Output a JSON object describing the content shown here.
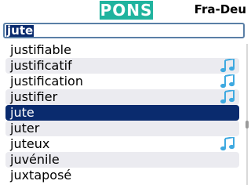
{
  "header": {
    "logo": "PONS",
    "language_pair": "Fra-Deu"
  },
  "search": {
    "value": "jute"
  },
  "list": {
    "items": [
      {
        "label": "justifiable",
        "audio": false,
        "selected": false
      },
      {
        "label": "justificatif",
        "audio": true,
        "selected": false
      },
      {
        "label": "justification",
        "audio": true,
        "selected": false
      },
      {
        "label": "justifier",
        "audio": true,
        "selected": false
      },
      {
        "label": "jute",
        "audio": false,
        "selected": true
      },
      {
        "label": "juter",
        "audio": false,
        "selected": false
      },
      {
        "label": "juteux",
        "audio": true,
        "selected": false
      },
      {
        "label": "juvénile",
        "audio": false,
        "selected": false
      },
      {
        "label": "juxtaposé",
        "audio": false,
        "selected": false
      }
    ]
  },
  "colors": {
    "logo_bg": "#1fb39e",
    "selection": "#0a2b6e",
    "row_alt": "#ebebf0",
    "audio_icon": "#3fa9e0"
  }
}
